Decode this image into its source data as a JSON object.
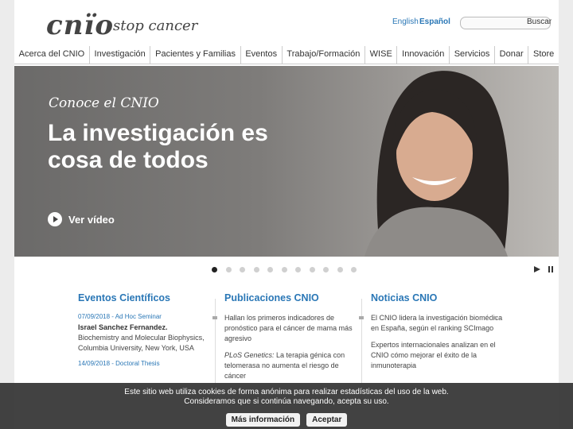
{
  "header": {
    "logo": "cnïo",
    "tagline": "stop cancer",
    "lang_en": "English",
    "lang_es": "Español",
    "search_button": "Buscar"
  },
  "nav": [
    "Acerca del CNIO",
    "Investigación",
    "Pacientes y Familias",
    "Eventos",
    "Trabajo/Formación",
    "WISE",
    "Innovación",
    "Servicios",
    "Donar",
    "Store"
  ],
  "hero": {
    "eyebrow": "Conoce el CNIO",
    "title": "La investigación es cosa de todos",
    "video_label": "Ver vídeo"
  },
  "carousel": {
    "slide_count": 11,
    "active_slide": 1
  },
  "columns": {
    "eventos": {
      "heading": "Eventos Científicos",
      "item1_meta": "07/09/2018 - Ad Hoc Seminar",
      "item1_name": "Israel Sanchez Fernandez.",
      "item1_text": "Biochemistry and Molecular Biophysics, Columbia University, New York, USA",
      "item2_meta": "14/09/2018 - Doctoral Thesis"
    },
    "publicaciones": {
      "heading": "Publicaciones CNIO",
      "item1_text": "Hallan los primeros indicadores de pronóstico para el cáncer de mama más agresivo",
      "item2_prefix": "PLoS Genetics:",
      "item2_text": " La terapia génica con telomerasa no aumenta el riesgo de cáncer"
    },
    "noticias": {
      "heading": "Noticias CNIO",
      "item1_text": "El CNIO lidera la investigación biomédica en España, según el ranking SCImago",
      "item2_text": "Expertos internacionales analizan en el CNIO cómo mejorar el éxito de la inmunoterapia"
    }
  },
  "cookie": {
    "line1": "Este sitio web utiliza cookies de forma anónima para realizar estadísticas del uso de la web.",
    "line2": "Consideramos que si continúa navegando, acepta su uso.",
    "more_button": "Más información",
    "accept_button": "Aceptar"
  }
}
